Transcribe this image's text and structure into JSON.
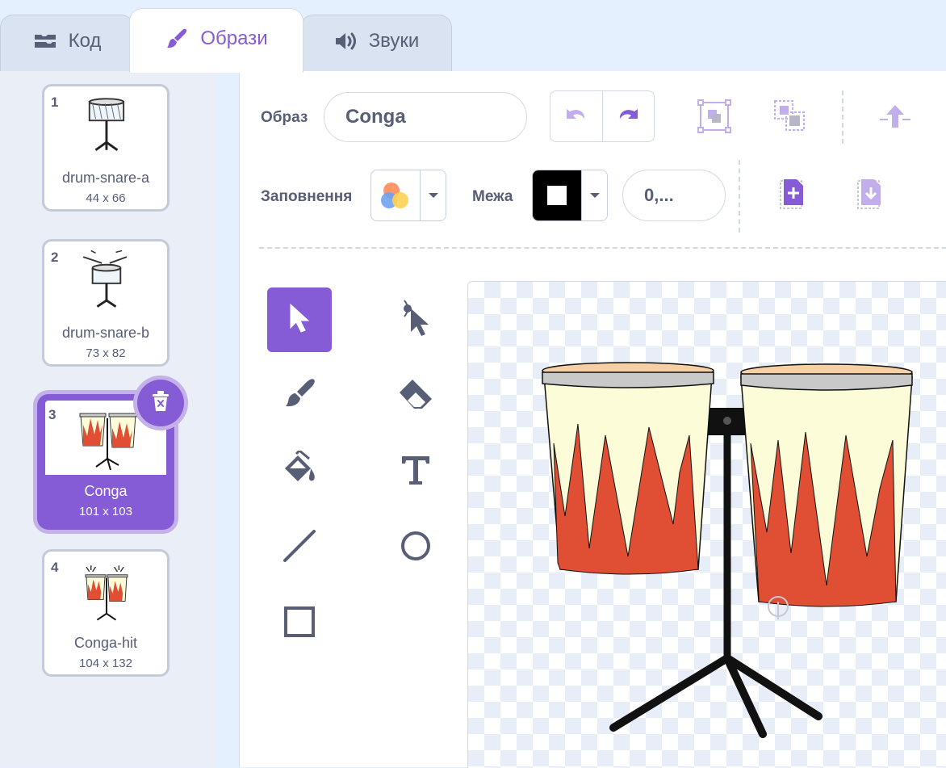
{
  "tabs": [
    {
      "label": "Код",
      "icon": "code-blocks-icon"
    },
    {
      "label": "Образи",
      "icon": "paintbrush-icon"
    },
    {
      "label": "Звуки",
      "icon": "speaker-icon"
    }
  ],
  "active_tab": "Образи",
  "costumes": [
    {
      "number": "1",
      "name": "drum-snare-a",
      "size": "44 x 66",
      "thumbnail": "snare-drum"
    },
    {
      "number": "2",
      "name": "drum-snare-b",
      "size": "73 x 82",
      "thumbnail": "snare-drum-with-sticks"
    },
    {
      "number": "3",
      "name": "Conga",
      "size": "101 x 103",
      "thumbnail": "conga-drums",
      "selected": true
    },
    {
      "number": "4",
      "name": "Conga-hit",
      "size": "104 x 132",
      "thumbnail": "conga-drums-hit"
    }
  ],
  "editor": {
    "costume_label": "Образ",
    "costume_name": "Conga",
    "fill_label": "Заповнення",
    "outline_label": "Межа",
    "outline_width": "0,...",
    "outline_color": "#000000",
    "toolbar_icons": [
      "undo-icon",
      "redo-icon",
      "group-icon",
      "ungroup-icon",
      "forward-icon",
      "add-costume-icon",
      "export-icon"
    ],
    "tools": [
      "select",
      "reshape",
      "brush",
      "eraser",
      "fill",
      "text",
      "line",
      "circle",
      "rectangle"
    ],
    "selected_tool": "select"
  },
  "colors": {
    "accent": "#855cd6",
    "conga_body": "#fdfcd8",
    "conga_flame": "#e04f33",
    "conga_head": "#f7cfa4"
  }
}
